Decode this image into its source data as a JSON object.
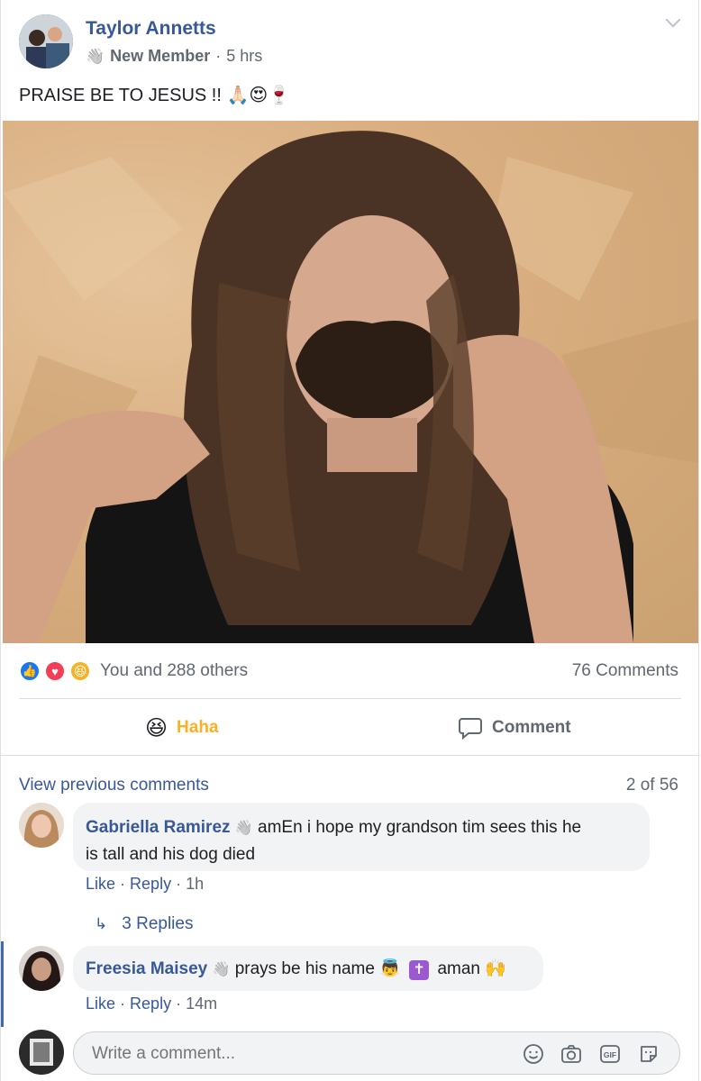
{
  "post": {
    "author": "Taylor Annetts",
    "badge": "New Member",
    "time": "5 hrs",
    "text": "PRAISE BE TO JESUS !! 🙏🏻😍🍷"
  },
  "stats": {
    "reactions_text": "You and 288 others",
    "comments_count": "76 Comments"
  },
  "actions": {
    "haha_label": "Haha",
    "comment_label": "Comment"
  },
  "comments_header": {
    "view_previous": "View previous comments",
    "count": "2 of 56"
  },
  "comments": [
    {
      "author": "Gabriella Ramirez",
      "line1": "amEn i hope my grandson tim sees this he",
      "line2": "is tall and his dog died",
      "like": "Like",
      "reply": "Reply",
      "time": "1h",
      "replies": "3 Replies"
    },
    {
      "author": "Freesia Maisey",
      "text": "prays be his name",
      "text2": "aman",
      "like": "Like",
      "reply": "Reply",
      "time": "14m"
    }
  ],
  "composer": {
    "placeholder": "Write a comment..."
  },
  "colors": {
    "link": "#385898",
    "haha": "#f7b125",
    "like_blue": "#1877f2",
    "love_red": "#f33e58"
  }
}
